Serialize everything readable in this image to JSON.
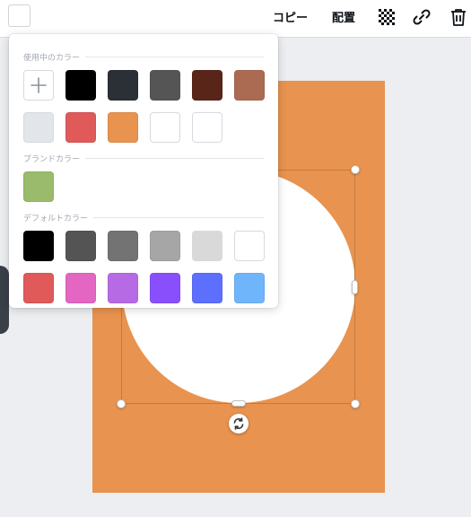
{
  "toolbar": {
    "copy_label": "コピー",
    "arrange_label": "配置",
    "icons": [
      "transparency-icon",
      "link-icon",
      "trash-icon"
    ],
    "current_color": "#ffffff"
  },
  "color_panel": {
    "used_colors_label": "使用中のカラー",
    "brand_colors_label": "ブランドカラー",
    "default_colors_label": "デフォルトカラー",
    "used_colors": [
      "#000000",
      "#2b2f36",
      "#555555",
      "#5a2519",
      "#ab6a52",
      "#e2e6ea",
      "#e05a5a",
      "#e8934f",
      "#ffffff",
      "#ffffff"
    ],
    "brand_colors": [
      "#99bb6b"
    ],
    "default_colors": [
      "#000000",
      "#545454",
      "#737373",
      "#a6a6a6",
      "#d9d9d9",
      "#ffffff",
      "#e05a5a",
      "#e266c2",
      "#b66ae4",
      "#8a4ffc",
      "#5d6ffd",
      "#6fb5fb"
    ]
  },
  "design": {
    "background_color": "#e8934f",
    "shape_color": "#ffffff",
    "selection_color": "#c47a3c"
  }
}
